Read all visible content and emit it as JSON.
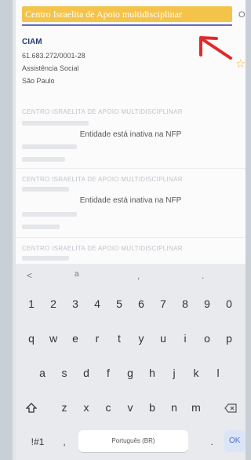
{
  "search": {
    "value": "Centro Israelita de Apoio multidisciplinar",
    "trailing_char": "O"
  },
  "first_result": {
    "name": "CIAM",
    "cnpj": "61.683.272/0001-28",
    "category": "Assistência Social",
    "city": "São Paulo"
  },
  "blurred_results": [
    {
      "title": "CENTRO ISRAELITA DE APOIO MULTIDISCIPLINAR",
      "status": "Entidade está inativa na NFP"
    },
    {
      "title": "CENTRO ISRAELITA DE APOIO MULTIDISCIPLINAR",
      "status": "Entidade está inativa na NFP"
    },
    {
      "title": "CENTRO ISRAELITA DE APOIO MULTIDISCIPLINAR",
      "status": ""
    }
  ],
  "keyboard": {
    "suggestions": [
      "<",
      "a",
      ",",
      "."
    ],
    "row_numbers": [
      "1",
      "2",
      "3",
      "4",
      "5",
      "6",
      "7",
      "8",
      "9",
      "0"
    ],
    "row_1": [
      "q",
      "w",
      "e",
      "r",
      "t",
      "y",
      "u",
      "i",
      "o",
      "p"
    ],
    "row_2": [
      "a",
      "s",
      "d",
      "f",
      "g",
      "h",
      "j",
      "k",
      "l"
    ],
    "row_3": [
      "z",
      "x",
      "c",
      "v",
      "b",
      "n",
      "m"
    ],
    "shift_icon": "shift-icon",
    "backspace_icon": "backspace-icon",
    "symbols_label": "!#1",
    "comma_label": ",",
    "space_label": "Português (BR)",
    "period_label": ".",
    "ok_label": "OK"
  },
  "colors": {
    "search_bg": "#f4c34a",
    "name_color": "#203a74",
    "arrow_red": "#e02a2a"
  }
}
